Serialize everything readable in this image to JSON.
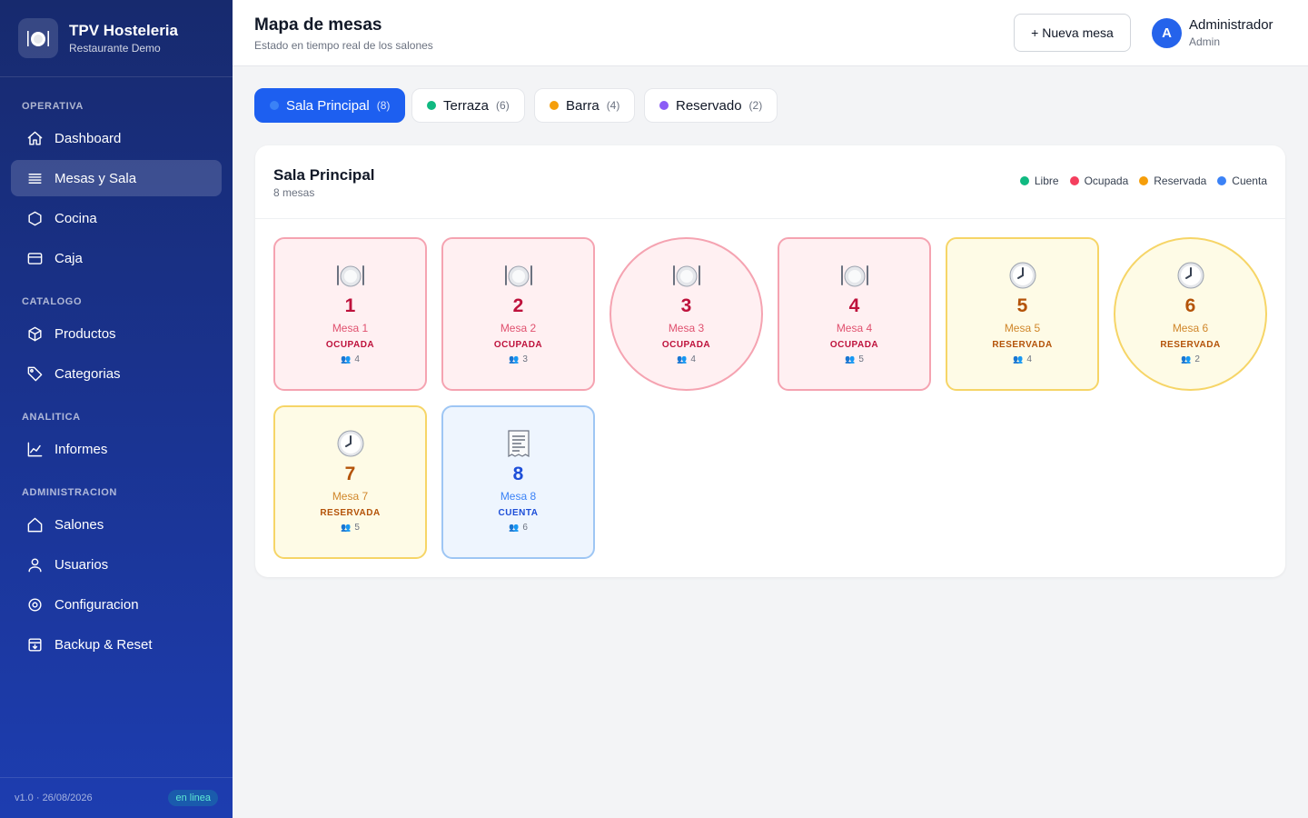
{
  "app": {
    "title": "TPV Hosteleria",
    "subtitle": "Restaurante Demo",
    "logo_icon": "plate-icon"
  },
  "sidebar": {
    "sections": [
      {
        "label": "OPERATIVA"
      },
      {
        "label": "CATALOGO"
      },
      {
        "label": "ANALITICA"
      },
      {
        "label": "ADMINISTRACION"
      }
    ],
    "items": [
      {
        "label": "Dashboard",
        "icon": "home-icon"
      },
      {
        "label": "Mesas y Sala",
        "icon": "list-icon",
        "active": true
      },
      {
        "label": "Cocina",
        "icon": "hexagon-icon"
      },
      {
        "label": "Caja",
        "icon": "cash-box-icon"
      },
      {
        "label": "Productos",
        "icon": "cube-icon"
      },
      {
        "label": "Categorias",
        "icon": "tag-icon"
      },
      {
        "label": "Informes",
        "icon": "line-chart-icon"
      },
      {
        "label": "Salones",
        "icon": "house-icon"
      },
      {
        "label": "Usuarios",
        "icon": "users-icon"
      },
      {
        "label": "Configuracion",
        "icon": "gear-icon"
      },
      {
        "label": "Backup & Reset",
        "icon": "archive-icon"
      }
    ],
    "footer": {
      "version": "v1.0 · 26/08/2026",
      "status": "en linea"
    }
  },
  "header": {
    "title": "Mapa de mesas",
    "subtitle": "Estado en tiempo real de los salones",
    "new_table_label": "+ Nueva mesa",
    "user": {
      "initial": "A",
      "name": "Administrador",
      "role": "Admin"
    }
  },
  "tabs": [
    {
      "label": "Sala Principal",
      "count": "(8)",
      "color": "#3b82f6",
      "active": true
    },
    {
      "label": "Terraza",
      "count": "(6)",
      "color": "#10b981"
    },
    {
      "label": "Barra",
      "count": "(4)",
      "color": "#f59e0b"
    },
    {
      "label": "Reservado",
      "count": "(2)",
      "color": "#8b5cf6"
    }
  ],
  "panel": {
    "title": "Sala Principal",
    "subtitle": "8 mesas",
    "legend": [
      {
        "label": "Libre",
        "color": "#10b981"
      },
      {
        "label": "Ocupada",
        "color": "#f43f5e"
      },
      {
        "label": "Reservada",
        "color": "#f59e0b"
      },
      {
        "label": "Cuenta",
        "color": "#3b82f6"
      }
    ]
  },
  "tables": [
    {
      "number": "1",
      "name": "Mesa 1",
      "status": "OCUPADA",
      "seats": "4",
      "icon": "plate-cutlery-icon"
    },
    {
      "number": "2",
      "name": "Mesa 2",
      "status": "OCUPADA",
      "seats": "3",
      "icon": "plate-cutlery-icon"
    },
    {
      "number": "3",
      "name": "Mesa 3",
      "status": "OCUPADA",
      "seats": "4",
      "icon": "plate-cutlery-icon"
    },
    {
      "number": "4",
      "name": "Mesa 4",
      "status": "OCUPADA",
      "seats": "5",
      "icon": "plate-cutlery-icon"
    },
    {
      "number": "5",
      "name": "Mesa 5",
      "status": "RESERVADA",
      "seats": "4",
      "icon": "clock-icon"
    },
    {
      "number": "6",
      "name": "Mesa 6",
      "status": "RESERVADA",
      "seats": "2",
      "icon": "clock-icon"
    },
    {
      "number": "7",
      "name": "Mesa 7",
      "status": "RESERVADA",
      "seats": "5",
      "icon": "clock-icon"
    },
    {
      "number": "8",
      "name": "Mesa 8",
      "status": "CUENTA",
      "seats": "6",
      "icon": "receipt-icon"
    }
  ]
}
